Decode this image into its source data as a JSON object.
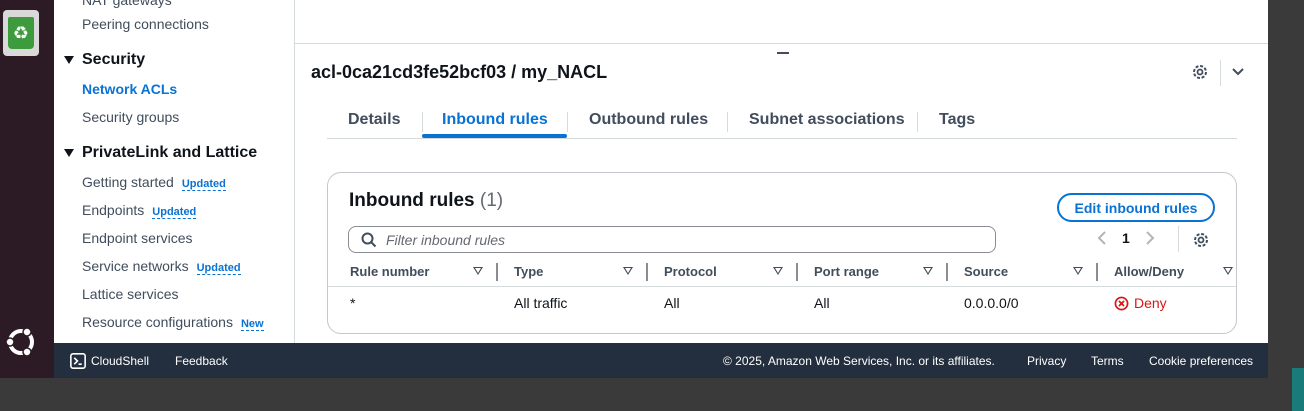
{
  "sidebar": {
    "partial_item": "NAT gateways",
    "peering": "Peering connections",
    "security_section": "Security",
    "network_acls": "Network ACLs",
    "security_groups": "Security groups",
    "privatelink_section": "PrivateLink and Lattice",
    "getting_started": "Getting started",
    "getting_started_badge": "Updated",
    "endpoints": "Endpoints",
    "endpoints_badge": "Updated",
    "endpoint_services": "Endpoint services",
    "service_networks": "Service networks",
    "service_networks_badge": "Updated",
    "lattice_services": "Lattice services",
    "resource_configurations": "Resource configurations",
    "resource_configurations_badge": "New"
  },
  "detail": {
    "title": "acl-0ca21cd3fe52bcf03 / my_NACL",
    "tabs": [
      "Details",
      "Inbound rules",
      "Outbound rules",
      "Subnet associations",
      "Tags"
    ],
    "active_tab": "Inbound rules"
  },
  "rules_panel": {
    "title": "Inbound rules",
    "count": "(1)",
    "edit_button": "Edit inbound rules",
    "filter_placeholder": "Filter inbound rules",
    "page": "1",
    "columns": [
      "Rule number",
      "Type",
      "Protocol",
      "Port range",
      "Source",
      "Allow/Deny"
    ],
    "rows": [
      {
        "rule_number": "*",
        "type": "All traffic",
        "protocol": "All",
        "port_range": "All",
        "source": "0.0.0.0/0",
        "action": "Deny"
      }
    ]
  },
  "footer": {
    "cloudshell": "CloudShell",
    "feedback": "Feedback",
    "copyright": "© 2025, Amazon Web Services, Inc. or its affiliates.",
    "privacy": "Privacy",
    "terms": "Terms",
    "cookies": "Cookie preferences"
  },
  "colors": {
    "accent": "#0972d3",
    "deny": "#d91515",
    "footer_bg": "#232f3e"
  }
}
